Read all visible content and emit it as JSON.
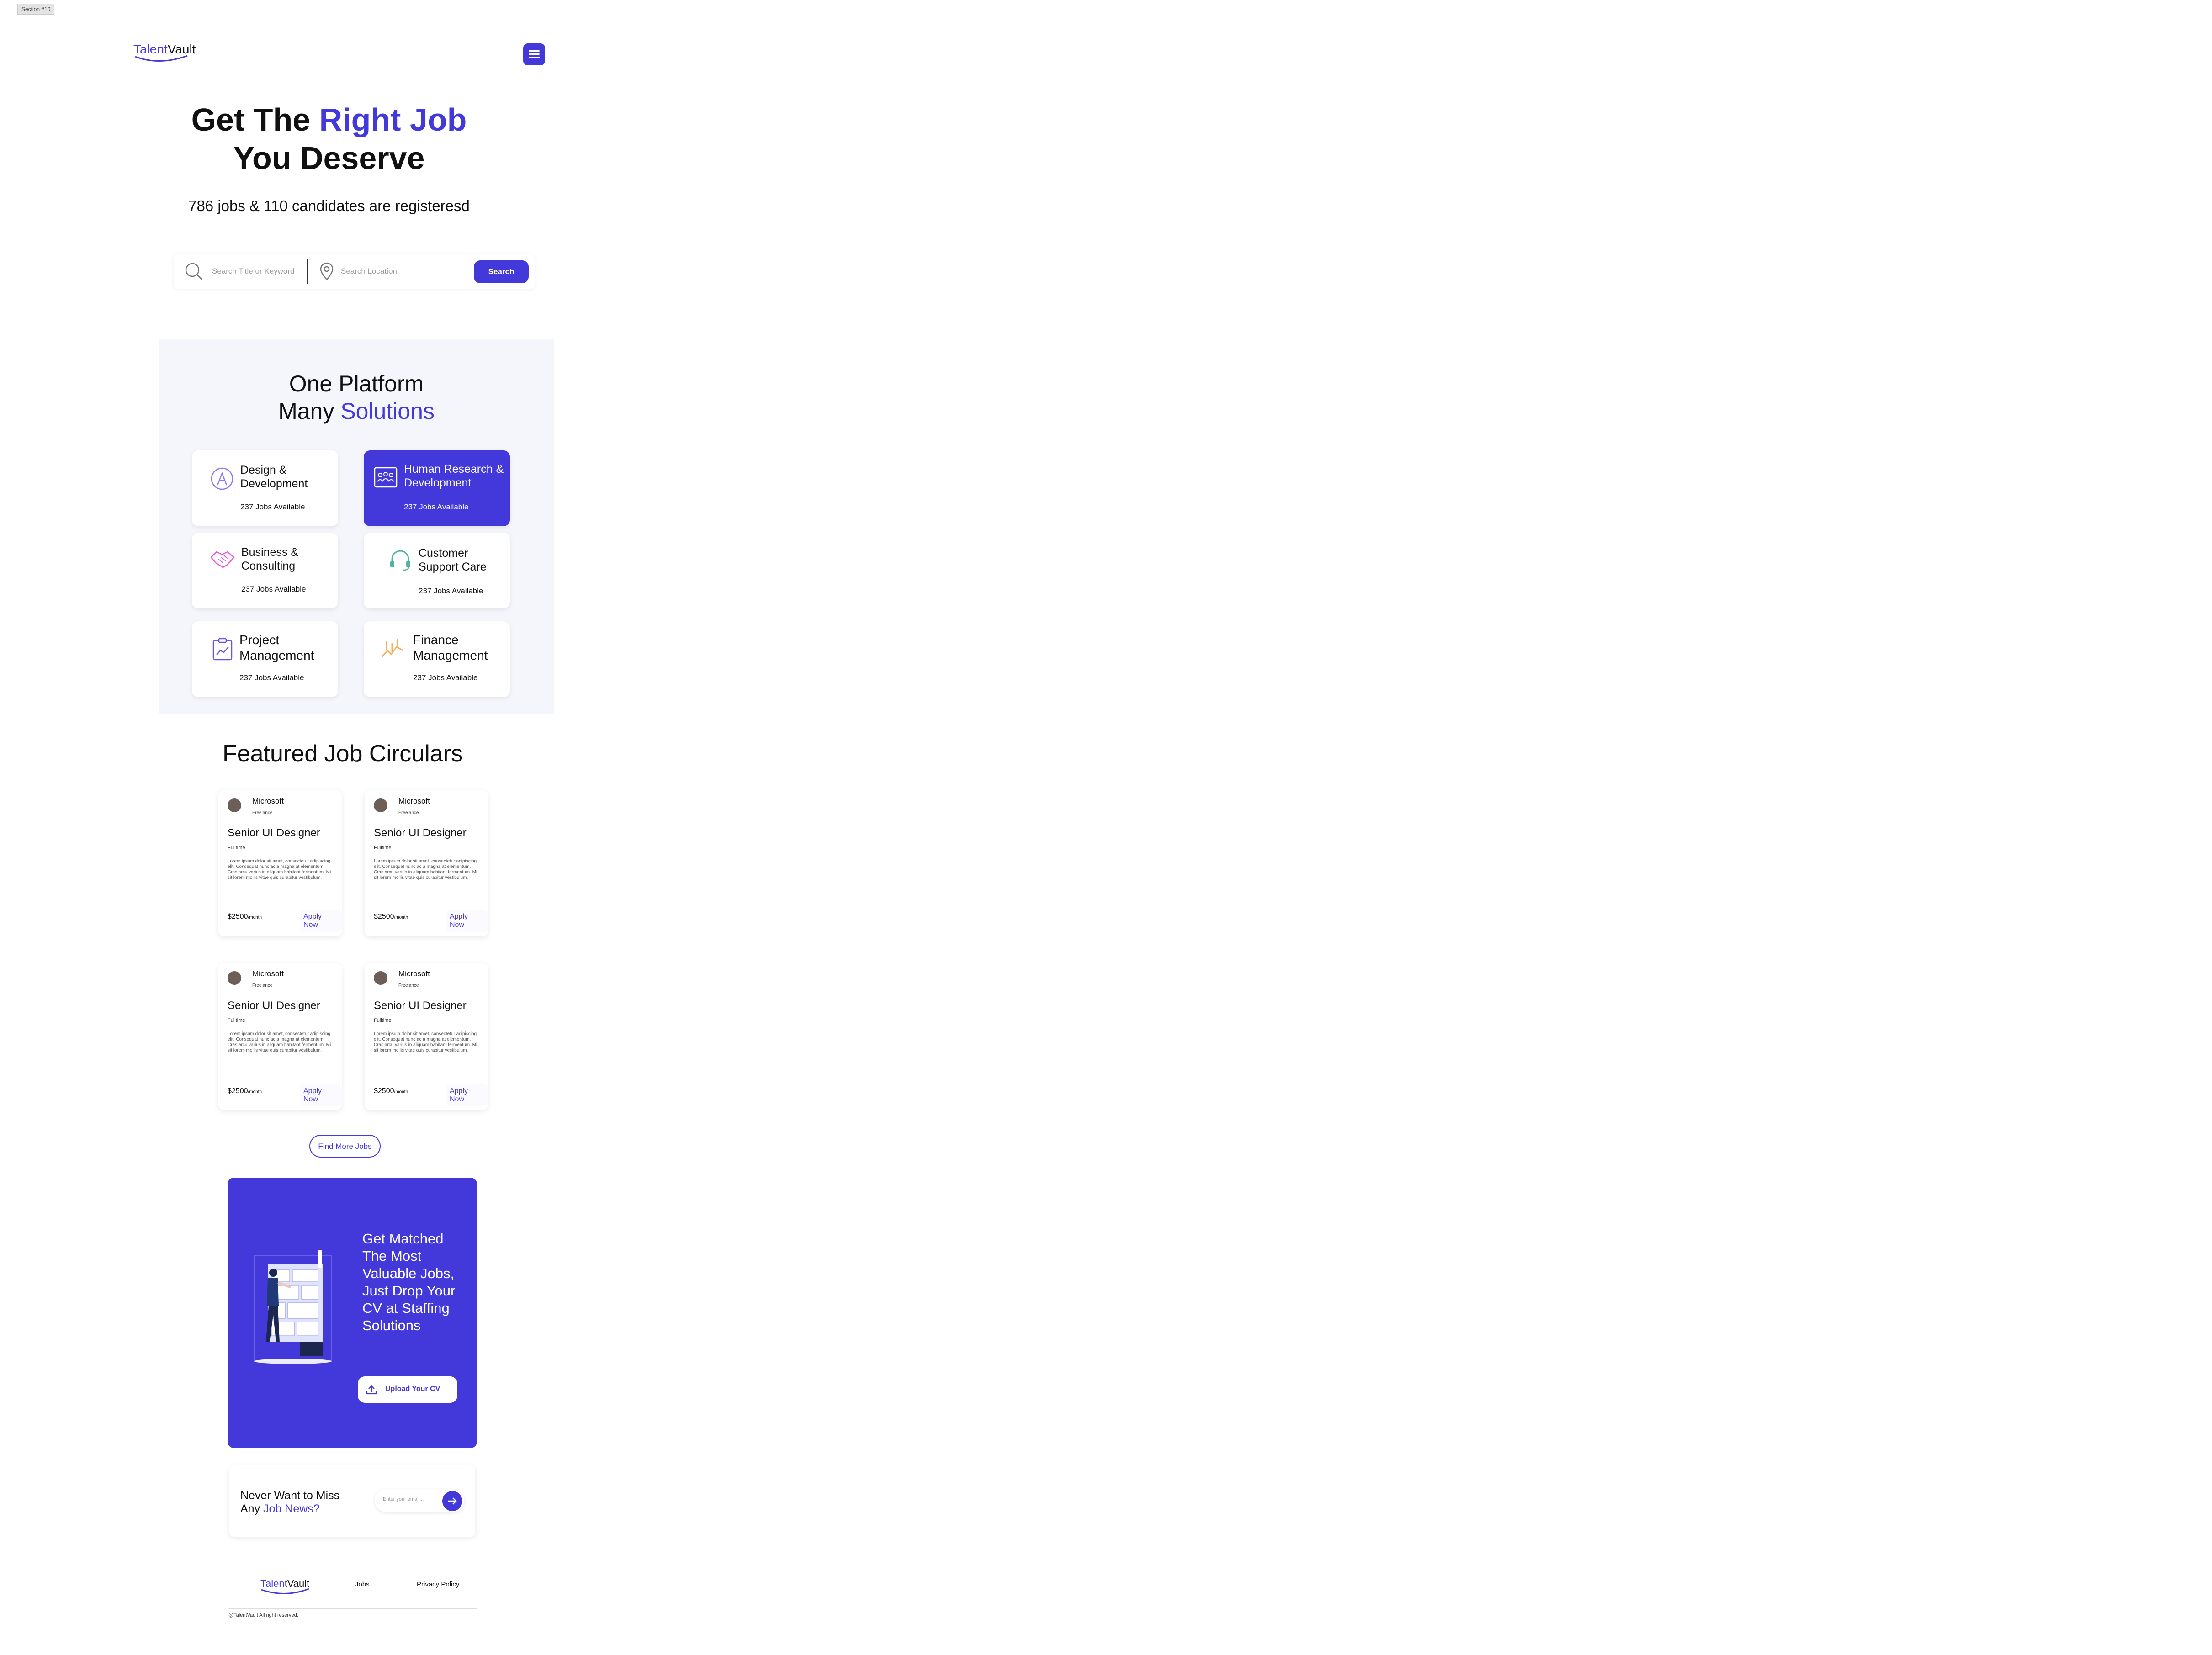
{
  "section_label": "Section #10",
  "brand": {
    "part1": "Talent",
    "part2": "Vault"
  },
  "hero": {
    "title_line1_plain": "Get The ",
    "title_line1_accent": "Right Job",
    "title_line2": "You Deserve",
    "subtitle": "786 jobs & 110 candidates are registeresd"
  },
  "search": {
    "keyword_placeholder": "Search Title or Keyword",
    "location_placeholder": "Search Location",
    "button_label": "Search"
  },
  "platform": {
    "title_line1": "One Platform",
    "title_line2_plain": "Many ",
    "title_line2_accent": "Solutions",
    "categories": [
      {
        "name_line1": "Design &",
        "name_line2": "Development",
        "count": "237 Jobs Available",
        "icon": "design-icon"
      },
      {
        "name_line1": "Human Research &",
        "name_line2": "Development",
        "count": "237 Jobs Available",
        "icon": "team-icon"
      },
      {
        "name_line1": "Business &",
        "name_line2": "Consulting",
        "count": "237 Jobs Available",
        "icon": "handshake-icon"
      },
      {
        "name_line1": "Customer",
        "name_line2": "Support Care",
        "count": "237 Jobs Available",
        "icon": "headset-icon"
      },
      {
        "name_line1": "Project",
        "name_line2": "Management",
        "count": "237 Jobs Available",
        "icon": "chart-board-icon"
      },
      {
        "name_line1": "Finance",
        "name_line2": "Management",
        "count": "237 Jobs Available",
        "icon": "finance-icon"
      }
    ],
    "colors": {
      "accent": "#4338d9",
      "section_bg": "#f5f6fc"
    }
  },
  "featured": {
    "title": "Featured Job Circulars",
    "jobs": [
      {
        "company": "Microsoft",
        "type": "Freelance",
        "title": "Senior UI Designer",
        "employment": "Fulltime",
        "description": "Lorem ipsum dolor sit amet, consectetur adipiscing elit. Consequat nunc ac a magna at elementum. Cras arcu varius in aliquam habitant fermentum. Mi sit lorem mollis vitae quis curabitur vestibulum.",
        "salary": "$2500",
        "per": "/month",
        "apply_label": "Apply Now"
      },
      {
        "company": "Microsoft",
        "type": "Freelance",
        "title": "Senior UI Designer",
        "employment": "Fulltime",
        "description": "Lorem ipsum dolor sit amet, consectetur adipiscing elit. Consequat nunc ac a magna at elementum. Cras arcu varius in aliquam habitant fermentum. Mi sit lorem mollis vitae quis curabitur vestibulum.",
        "salary": "$2500",
        "per": "/month",
        "apply_label": "Apply Now"
      },
      {
        "company": "Microsoft",
        "type": "Freelance",
        "title": "Senior UI Designer",
        "employment": "Fulltime",
        "description": "Lorem ipsum dolor sit amet, consectetur adipiscing elit. Consequat nunc ac a magna at elementum. Cras arcu varius in aliquam habitant fermentum. Mi sit lorem mollis vitae quis curabitur vestibulum.",
        "salary": "$2500",
        "per": "/month",
        "apply_label": "Apply Now"
      },
      {
        "company": "Microsoft",
        "type": "Freelance",
        "title": "Senior UI Designer",
        "employment": "Fulltime",
        "description": "Lorem ipsum dolor sit amet, consectetur adipiscing elit. Consequat nunc ac a magna at elementum. Cras arcu varius in aliquam habitant fermentum. Mi sit lorem mollis vitae quis curabitur vestibulum.",
        "salary": "$2500",
        "per": "/month",
        "apply_label": "Apply Now"
      }
    ],
    "more_button": "Find More Jobs"
  },
  "cv_banner": {
    "text": "Get Matched The Most Valuable Jobs, Just Drop Your CV at Staffing Solutions",
    "button_label": "Upload Your CV"
  },
  "newsletter": {
    "text_line1": "Never Want to Miss",
    "text_line2_plain": "Any ",
    "text_line2_accent": "Job News?",
    "email_placeholder": "Enter your email..."
  },
  "footer": {
    "links": [
      "Jobs",
      "Privacy Policy"
    ],
    "copyright": "@TalentVault All right reserved."
  }
}
